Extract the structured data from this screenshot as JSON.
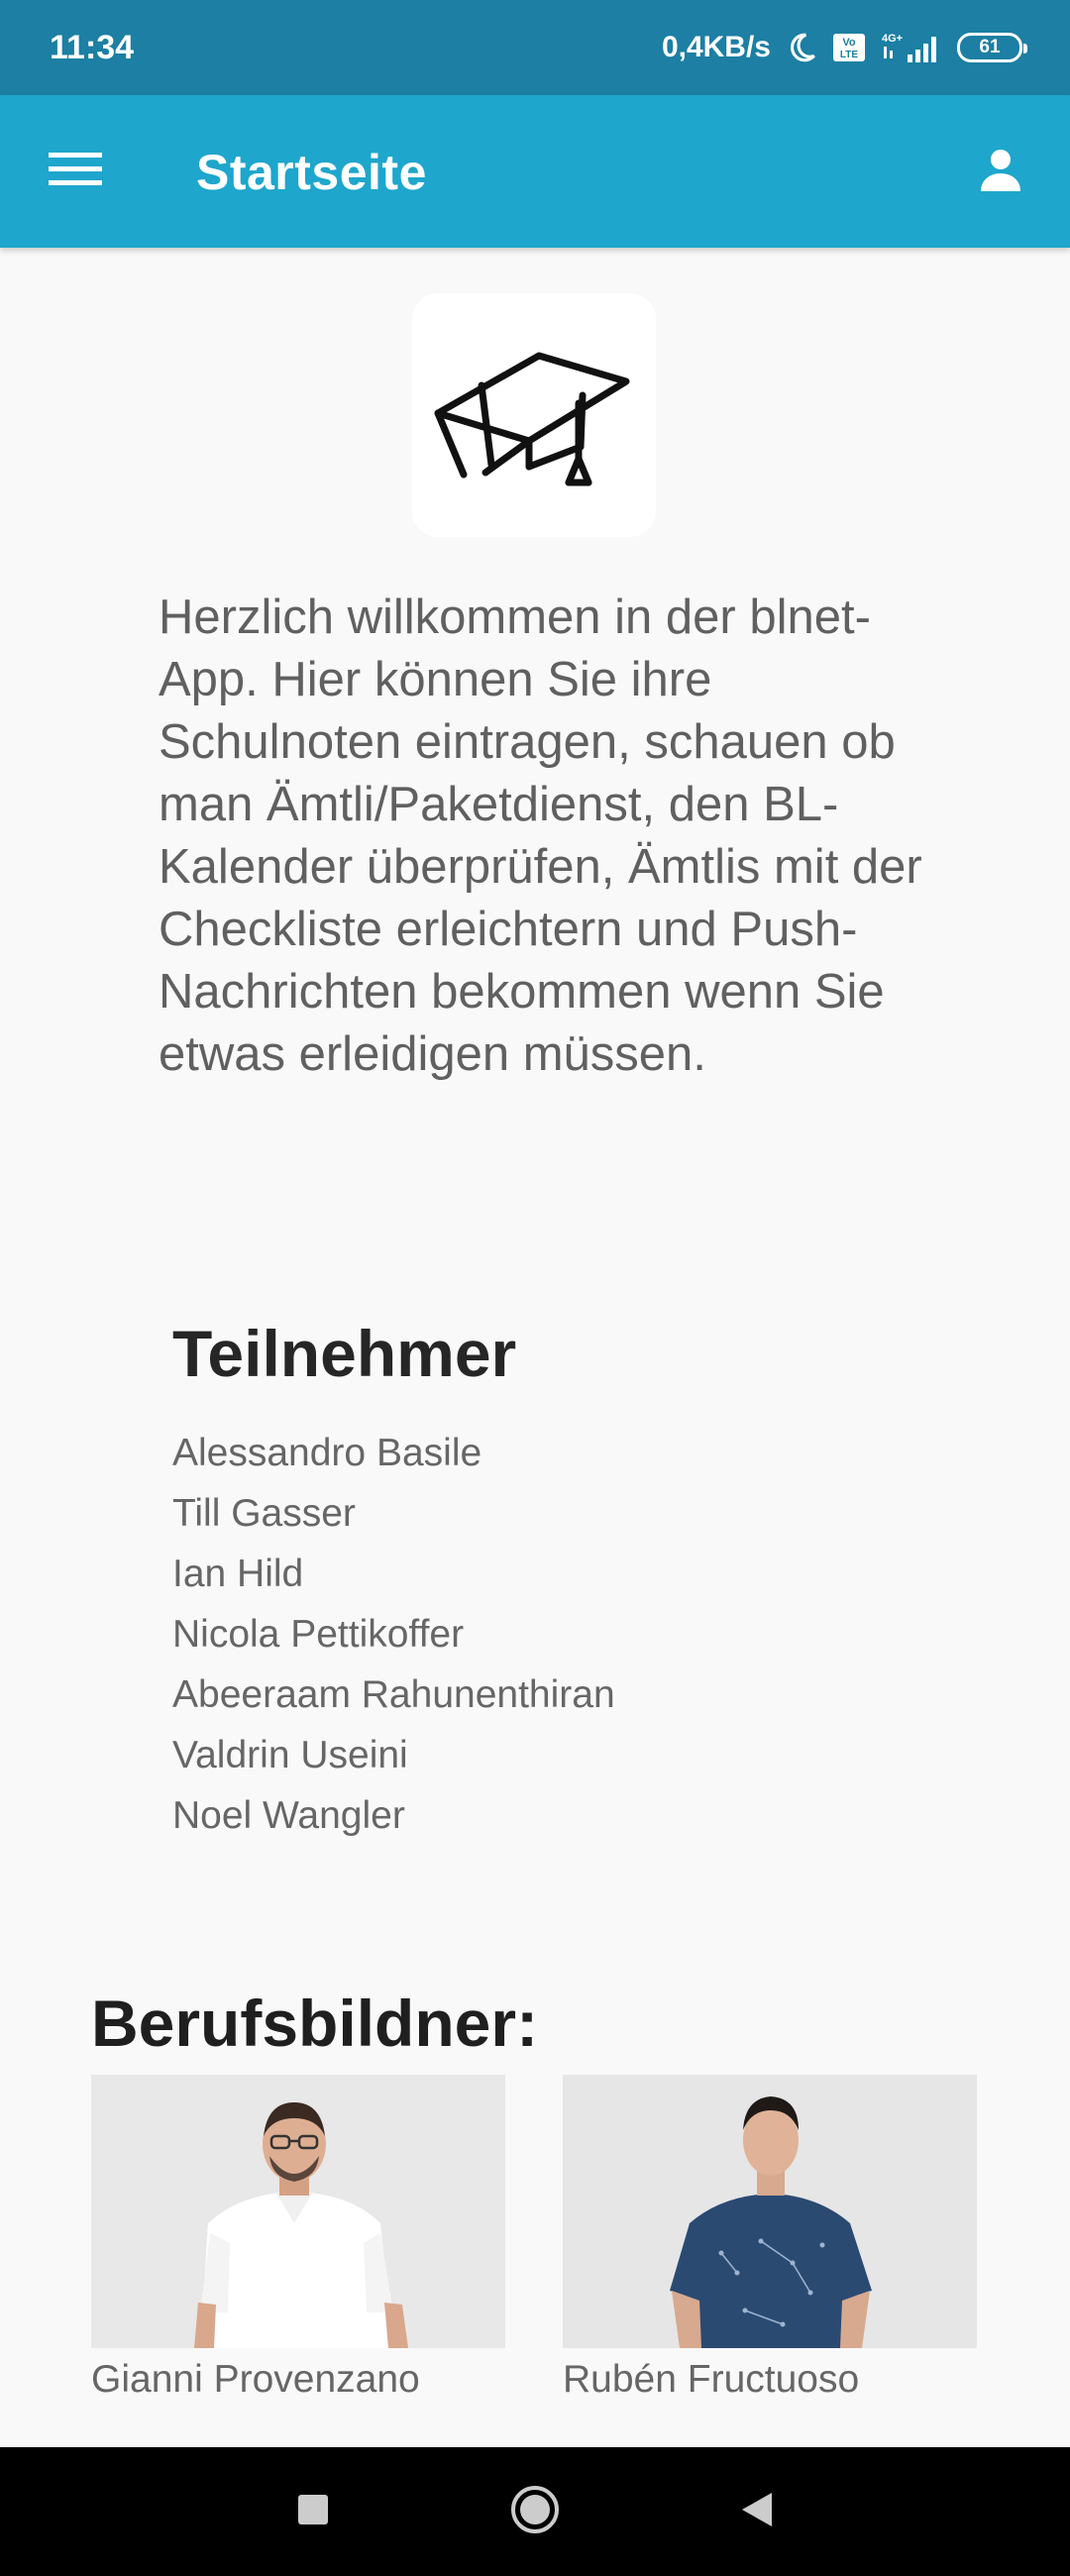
{
  "status_bar": {
    "time": "11:34",
    "net_speed": "0,4KB/s",
    "volte_top": "Vo",
    "volte_bottom": "LTE",
    "network": "4G+",
    "battery": "61"
  },
  "app_bar": {
    "title": "Startseite",
    "menu_icon": "hamburger-menu-icon",
    "profile_icon": "person-icon",
    "color": "#1ea6cc"
  },
  "logo": {
    "icon": "graduation-cap-icon"
  },
  "intro": {
    "text": "Herzlich willkommen in der blnet-App. Hier können Sie ihre Schulnoten eintragen, schauen ob man Ämtli/Paketdienst, den BL-Kalender überprüfen, Ämtlis mit der Checkliste erleichtern und Push-Nachrichten bekommen wenn Sie etwas erleidigen müssen."
  },
  "participants": {
    "title": "Teilnehmer",
    "names": [
      "Alessandro Basile",
      "Till Gasser",
      "Ian Hild",
      "Nicola Pettikoffer",
      "Abeeraam Rahunenthiran",
      "Valdrin Useini",
      "Noel Wangler"
    ]
  },
  "trainers": {
    "title": "Berufsbildner:",
    "people": [
      {
        "name": "Gianni Provenzano"
      },
      {
        "name": "Rubén Fructuoso"
      }
    ]
  },
  "nav_bar": {
    "recents_icon": "square-recents-icon",
    "home_icon": "circle-home-icon",
    "back_icon": "triangle-back-icon"
  }
}
